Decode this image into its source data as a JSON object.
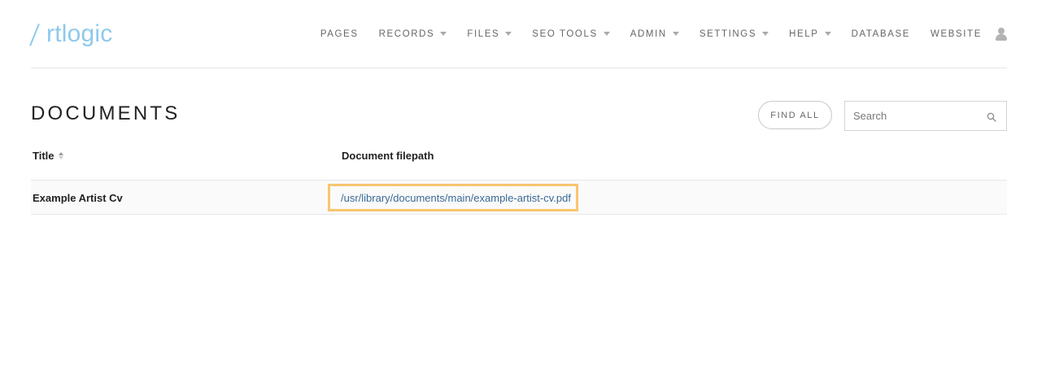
{
  "header": {
    "logo_text": "rtlogic",
    "logo_full": "Artlogic",
    "nav": [
      {
        "label": "PAGES",
        "has_dropdown": false
      },
      {
        "label": "RECORDS",
        "has_dropdown": true
      },
      {
        "label": "FILES",
        "has_dropdown": true
      },
      {
        "label": "SEO TOOLS",
        "has_dropdown": true
      },
      {
        "label": "ADMIN",
        "has_dropdown": true
      },
      {
        "label": "SETTINGS",
        "has_dropdown": true
      },
      {
        "label": "HELP",
        "has_dropdown": true
      },
      {
        "label": "DATABASE",
        "has_dropdown": false
      },
      {
        "label": "WEBSITE",
        "has_dropdown": false
      }
    ],
    "user_icon": "user-icon"
  },
  "page": {
    "title": "DOCUMENTS",
    "find_all_label": "FIND ALL",
    "search": {
      "placeholder": "Search",
      "value": ""
    }
  },
  "table": {
    "columns": [
      "Title",
      "Document filepath"
    ],
    "rows": [
      {
        "title": "Example Artist Cv",
        "filepath": "/usr/library/documents/main/example-artist-cv.pdf"
      }
    ]
  },
  "colors": {
    "logo": "#8ec9ec",
    "link": "#3b6a96",
    "highlight_border": "#f7c66e",
    "nav_text": "#666666"
  }
}
